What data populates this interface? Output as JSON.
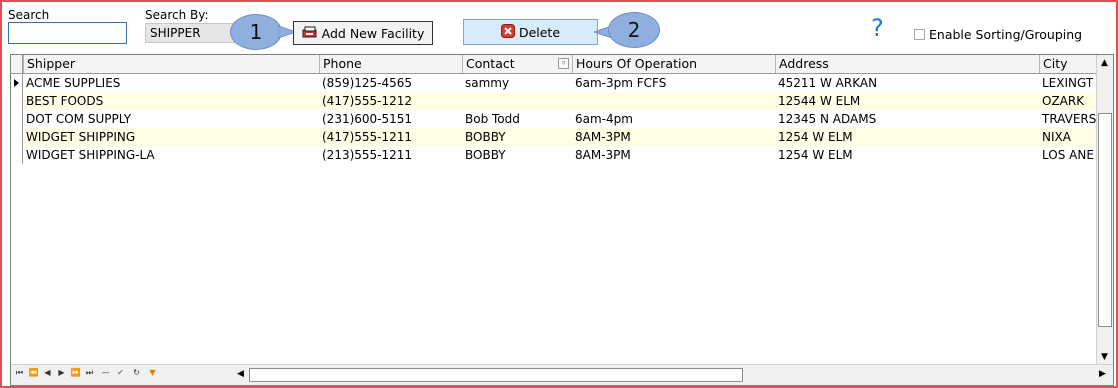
{
  "search": {
    "label": "Search",
    "value": "",
    "placeholder": ""
  },
  "search_by": {
    "label": "Search By:",
    "value": "SHIPPER"
  },
  "toolbar": {
    "add_label": "Add New Facility",
    "delete_label": "Delete"
  },
  "callouts": [
    "1",
    "2"
  ],
  "help": {
    "symbol": "?"
  },
  "sorting": {
    "label": "Enable Sorting/Grouping",
    "checked": false
  },
  "grid": {
    "columns": [
      "Shipper",
      "Phone",
      "Contact",
      "Hours Of Operation",
      "Address",
      "City"
    ],
    "rows": [
      {
        "shipper": "ACME SUPPLIES",
        "phone": "(859)125-4565",
        "contact": "sammy",
        "hours": "6am-3pm FCFS",
        "address": "45211 W ARKAN",
        "city": "LEXINGT"
      },
      {
        "shipper": "BEST FOODS",
        "phone": "(417)555-1212",
        "contact": "",
        "hours": "",
        "address": "12544 W ELM",
        "city": "OZARK"
      },
      {
        "shipper": "DOT COM SUPPLY",
        "phone": "(231)600-5151",
        "contact": "Bob Todd",
        "hours": "6am-4pm",
        "address": "12345 N ADAMS",
        "city": "TRAVERS"
      },
      {
        "shipper": "WIDGET SHIPPING",
        "phone": "(417)555-1211",
        "contact": "BOBBY",
        "hours": "8AM-3PM",
        "address": "1254 W ELM",
        "city": "NIXA"
      },
      {
        "shipper": "WIDGET SHIPPING-LA",
        "phone": "(213)555-1211",
        "contact": "BOBBY",
        "hours": "8AM-3PM",
        "address": "1254 W ELM",
        "city": "LOS ANE"
      }
    ]
  },
  "colors": {
    "frame": "#e05050",
    "alt_row": "#fffde3",
    "delete_bg": "#d7ecf8",
    "callout": "#8fb0df",
    "help": "#1a73e8"
  }
}
